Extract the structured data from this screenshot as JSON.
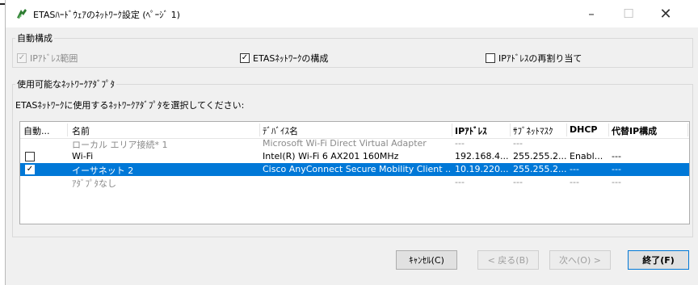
{
  "window": {
    "title": "ETASﾊｰﾄﾞｳｪｱのﾈｯﾄﾜｰｸ設定 (ﾍﾟｰｼﾞ 1)",
    "minimize_glyph": "–",
    "maximize_glyph": "☐",
    "close_glyph": "✕"
  },
  "auto_config": {
    "group_label": "自動構成",
    "ip_range": {
      "label": "IPｱﾄﾞﾚｽ範囲",
      "checked": true,
      "disabled": true,
      "mark": "✓"
    },
    "etas_network": {
      "label": "ETASﾈｯﾄﾜｰｸの構成",
      "checked": true,
      "mark": "✓"
    },
    "ip_reassign": {
      "label": "IPｱﾄﾞﾚｽの再割り当て",
      "checked": false,
      "mark": ""
    }
  },
  "adapters": {
    "group_label": "使用可能なﾈｯﾄﾜｰｸｱﾀﾞﾌﾟﾀ",
    "instruction": "ETASﾈｯﾄﾜｰｸに使用するﾈｯﾄﾜｰｸｱﾀﾞﾌﾟﾀを選択してください:",
    "columns": [
      "自動...",
      "名前",
      "ﾃﾞﾊﾞｲｽ名",
      "IPｱﾄﾞﾚｽ",
      "ｻﾌﾞﾈｯﾄﾏｽｸ",
      "DHCP",
      "代替IP構成"
    ],
    "rows": [
      {
        "checkbox": false,
        "check_mark": "",
        "name": "ローカル エリア接続* 1",
        "device": "Microsoft Wi-Fi Direct Virtual Adapter",
        "ip": "---",
        "subnet": "---",
        "dhcp": "",
        "alt_ip": "",
        "state": "greyed"
      },
      {
        "checkbox": true,
        "check_mark": "",
        "name": "Wi-Fi",
        "device": "Intel(R) Wi-Fi 6 AX201 160MHz",
        "ip": "192.168.4...",
        "subnet": "255.255.2...",
        "dhcp": "Enabl...",
        "alt_ip": "---",
        "state": "normal"
      },
      {
        "checkbox": true,
        "check_mark": "✓",
        "name": "イーサネット 2",
        "device": "Cisco AnyConnect Secure Mobility Client ...",
        "ip": "10.19.220...",
        "subnet": "255.255.2...",
        "dhcp": "---",
        "alt_ip": "---",
        "state": "selected"
      },
      {
        "checkbox": false,
        "check_mark": "",
        "name": "ｱﾀﾞﾌﾟﾀなし",
        "device": "",
        "ip": "---",
        "subnet": "---",
        "dhcp": "---",
        "alt_ip": "---",
        "state": "greyed"
      }
    ]
  },
  "buttons": {
    "cancel": "ｷｬﾝｾﾙ(C)",
    "back": "< 戻る(B)",
    "next": "次へ(O) >",
    "finish": "終了(F)"
  },
  "colors": {
    "selection": "#0078d7",
    "window_bg": "#f0f0f0",
    "app_icon": "#2e7d32"
  }
}
